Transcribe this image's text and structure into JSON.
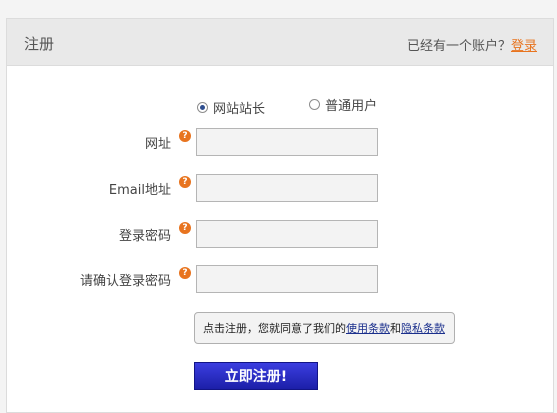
{
  "header": {
    "title": "注册",
    "login_prompt": "已经有一个账户？",
    "login_link": "登录"
  },
  "account_type": {
    "options": [
      {
        "label": "网站站长",
        "checked": true
      },
      {
        "label": "普通用户",
        "checked": false
      }
    ]
  },
  "form": {
    "fields": [
      {
        "label": "网址",
        "value": ""
      },
      {
        "label": "Email地址",
        "value": ""
      },
      {
        "label": "登录密码",
        "value": ""
      },
      {
        "label": "请确认登录密码",
        "value": ""
      }
    ],
    "help_glyph": "?"
  },
  "agreement": {
    "prefix": "点击注册，您就同意了我们的",
    "terms_link": "使用条款",
    "conjunction": "和",
    "privacy_link": "隐私条款"
  },
  "submit_label": "立即注册!",
  "colors": {
    "accent": "#e8741f",
    "button": "#2528c4",
    "link": "#1a2f8c"
  }
}
